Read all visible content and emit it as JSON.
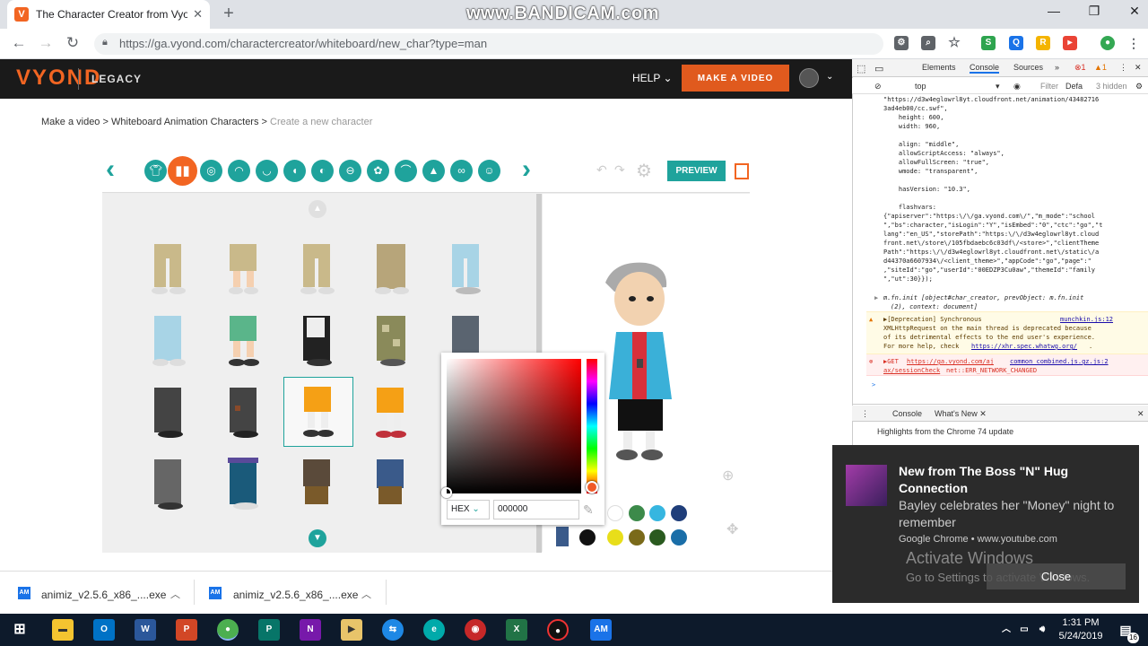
{
  "browser": {
    "tab_title": "The Character Creator from Vyond",
    "tab_close": "✕",
    "new_tab": "+",
    "watermark": "www.BANDICAM.com",
    "url": "https://ga.vyond.com/charactercreator/whiteboard/new_char?type=man"
  },
  "vyond": {
    "logo": "VYOND",
    "legacy": "LEGACY",
    "help": "HELP ⌄",
    "make_video": "MAKE A VIDEO",
    "breadcrumb": {
      "item1": "Make a video",
      "sep": ">",
      "item2": "Whiteboard Animation Characters",
      "current": "Create a new character"
    },
    "preview_button": "PREVIEW"
  },
  "picker": {
    "mode": "HEX",
    "value": "000000",
    "swatches_row1": [
      "#ffffff",
      "#3c8a4a",
      "#36b6e0",
      "#1f3e7a"
    ],
    "swatches_row2": [
      "#111111",
      "#e8de1a",
      "#7a6a1a",
      "#2a5a1f",
      "#1a6ea8"
    ]
  },
  "devtools": {
    "tabs": [
      "Elements",
      "Console",
      "Sources"
    ],
    "errors": "1",
    "warnings": "1",
    "context": "top",
    "filter": "Filter",
    "levels": "Defa",
    "hidden": "3 hidden",
    "code_lines": [
      "\"https://d3w4eglowrl8yt.cloudfront.net/animation/43482716",
      "3ad4eb00/cc.swf\",",
      "    height: 600,",
      "    width: 960,",
      "",
      "    align: \"middle\",",
      "    allowScriptAccess: \"always\",",
      "    allowFullScreen: \"true\",",
      "    wmode: \"transparent\",",
      "",
      "    hasVersion: \"10.3\",",
      "",
      "    flashvars:",
      "{\"apiserver\":\"https:\\/\\/ga.vyond.com\\/\",\"m_mode\":\"school",
      "\",\"bs\":character,\"isLogin\":\"Y\",\"isEmbed\":\"0\",\"ctc\":\"go\",\"t",
      "lang\":\"en_US\",\"storePath\":\"https:\\/\\/d3w4eglowrl8yt.cloud",
      "front.net\\/store\\/105fbdaebc6c03df\\/<store>\",\"clientTheme",
      "Path\":\"https:\\/\\/d3w4eglowrl8yt.cloudfront.net\\/static\\/a",
      "d44370a6607934\\/<client_theme>\",\"appCode\":\"go\",\"page\":\"",
      ",\"siteId\":\"go\",\"userId\":\"00EDZP3Cu0aw\",\"themeId\":\"family",
      "\",\"ut\":30}});"
    ],
    "init_line1": "m.fn.init [object#char_creator, prevObject: m.fn.init",
    "init_line2": "(2), context: document]",
    "warn_lines": [
      "▶[Deprecation] Synchronous",
      "XMLHttpRequest on the main thread is deprecated because",
      "of its detrimental effects to the end user's experience.",
      "For more help, check"
    ],
    "warn_source": "munchkin.js:12",
    "warn_link": "https://xhr.spec.whatwg.org/",
    "warn_end": ".",
    "err_get": "▶GET",
    "err_url1": "https://ga.vyond.com/aj",
    "err_src": "common_combined.js.gz.js:2",
    "err_url2": "ax/sessionCheck",
    "err_msg": "net::ERR_NETWORK_CHANGED",
    "prompt": ">",
    "drawer_tabs": [
      "Console",
      "What's New ✕"
    ],
    "highlights": "Highlights from the Chrome 74 update"
  },
  "toast": {
    "title": "New from The Boss \"N\" Hug Connection",
    "body": "Bayley celebrates her \"Money\" night to remember",
    "source": "Google Chrome • www.youtube.com",
    "close": "Close"
  },
  "activation": {
    "line1": "Activate Windows",
    "line2": "Go to Settings to activate Windows."
  },
  "downloads": [
    {
      "name": "animiz_v2.5.6_x86_....exe"
    },
    {
      "name": "animiz_v2.5.6_x86_....exe"
    }
  ],
  "taskbar": {
    "time": "1:31 PM",
    "date": "5/24/2019",
    "notifications": "16"
  }
}
